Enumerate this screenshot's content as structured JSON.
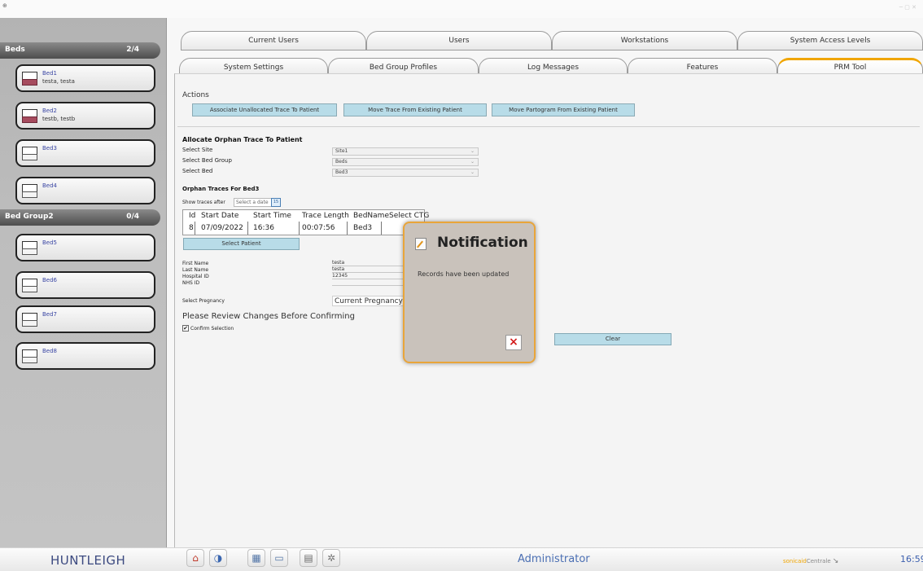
{
  "titlebar": {
    "left_text": "⊕"
  },
  "sidebar": {
    "groups": [
      {
        "name": "Beds",
        "count": "2/4"
      },
      {
        "name": "Bed Group2",
        "count": "0/4"
      }
    ],
    "beds": [
      {
        "name": "Bed1",
        "patient": "testa, testa"
      },
      {
        "name": "Bed2",
        "patient": "testb, testb"
      },
      {
        "name": "Bed3",
        "patient": ""
      },
      {
        "name": "Bed4",
        "patient": ""
      },
      {
        "name": "Bed5",
        "patient": ""
      },
      {
        "name": "Bed6",
        "patient": ""
      },
      {
        "name": "Bed7",
        "patient": ""
      },
      {
        "name": "Bed8",
        "patient": ""
      }
    ]
  },
  "tabs": {
    "row1": [
      "Current Users",
      "Users",
      "Workstations",
      "System Access Levels"
    ],
    "row2": [
      "System Settings",
      "Bed Group Profiles",
      "Log Messages",
      "Features",
      "PRM Tool"
    ],
    "active": "PRM Tool"
  },
  "actions": {
    "heading": "Actions",
    "buttons": [
      "Associate Unallocated Trace To Patient",
      "Move Trace From Existing Patient",
      "Move Partogram From Existing Patient"
    ]
  },
  "allocate": {
    "heading": "Allocate Orphan Trace To Patient",
    "site_label": "Select Site",
    "site_value": "Site1",
    "group_label": "Select Bed Group",
    "group_value": "Beds",
    "bed_label": "Select Bed",
    "bed_value": "Bed3"
  },
  "orphan": {
    "heading": "Orphan Traces For Bed3",
    "show_after": "Show traces after",
    "date_placeholder": "Select a date",
    "cal_icon": "15",
    "columns": [
      "Id",
      "Start Date",
      "Start Time",
      "Trace Length",
      "BedName",
      "Select CTG"
    ],
    "row": [
      "8",
      "07/09/2022",
      "16:36",
      "00:07:56",
      "Bed3",
      "S"
    ]
  },
  "patient": {
    "select_button": "Select Patient",
    "first_name_label": "First Name",
    "first_name": "testa",
    "last_name_label": "Last Name",
    "last_name": "testa",
    "hospital_id_label": "Hospital ID",
    "hospital_id": "12345",
    "nhs_label": "NHS ID",
    "nhs_id": "",
    "pregnancy_label": "Select Pregnancy",
    "pregnancy_value": "Current Pregnancy",
    "review_text": "Please Review Changes Before Confirming",
    "confirm_label": "Confirm Selection",
    "confirm_checked": "✔",
    "clear_button": "Clear"
  },
  "notification": {
    "title": "Notification",
    "message": "Records have been updated",
    "close_glyph": "×"
  },
  "footer": {
    "logo": "HUNTLEIGH",
    "toolbar_glyphs": [
      "⌂",
      "◑",
      "▦",
      "▭",
      "▤",
      "✲"
    ],
    "user": "Administrator",
    "brand_left": "sonicaid",
    "brand_right": "Centrale",
    "time": "16:59"
  }
}
